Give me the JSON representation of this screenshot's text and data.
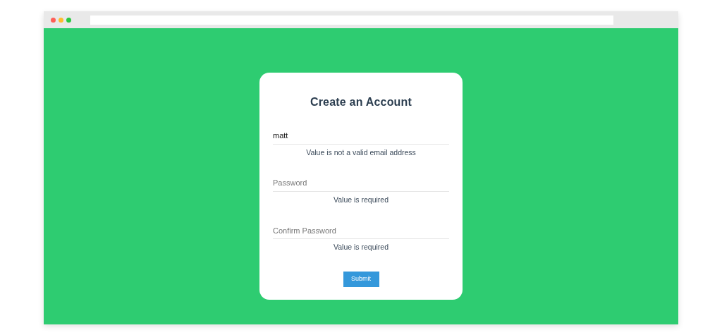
{
  "form": {
    "title": "Create an Account",
    "fields": [
      {
        "value": "matt",
        "kind": "text",
        "error": "Value is not a valid email address"
      },
      {
        "placeholder": "Password",
        "kind": "password",
        "error": "Value is required"
      },
      {
        "placeholder": "Confirm Password",
        "kind": "password",
        "error": "Value is required"
      }
    ],
    "submit": "Submit"
  }
}
